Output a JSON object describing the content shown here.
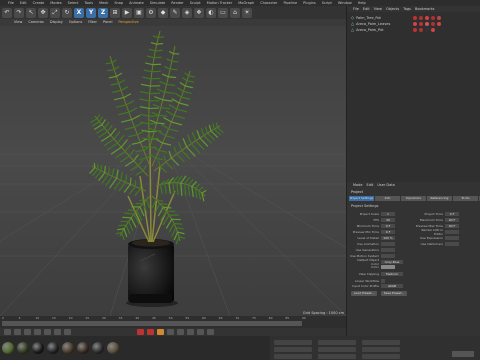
{
  "menubar": [
    "File",
    "Edit",
    "Create",
    "Modes",
    "Select",
    "Tools",
    "Mesh",
    "Snap",
    "Animate",
    "Simulate",
    "Render",
    "Sculpt",
    "Motion Tracker",
    "MoGraph",
    "Character",
    "Pipeline",
    "Plugins",
    "Script",
    "Window",
    "Help"
  ],
  "toolbar_icons": [
    "undo-icon",
    "redo-icon",
    "select-icon",
    "move-icon",
    "scale-icon",
    "rotate-icon",
    "x-axis-icon",
    "y-axis-icon",
    "z-axis-icon",
    "coord-icon",
    "render-view-icon",
    "render-icon",
    "render-settings-icon",
    "cube-icon",
    "pen-icon",
    "subdivision-icon",
    "array-icon",
    "deformer-icon",
    "floor-icon",
    "camera-icon",
    "light-icon"
  ],
  "toolbar_labels": {
    "x": "X",
    "y": "Y",
    "z": "Z"
  },
  "viewport_menu": {
    "items": [
      "View",
      "Cameras",
      "Display",
      "Options",
      "Filter",
      "Panel"
    ],
    "perspective_label": "Perspective"
  },
  "viewport": {
    "readout": "Grid Spacing : 1000 cm"
  },
  "timeline": {
    "ticks": [
      "0",
      "5",
      "10",
      "15",
      "20",
      "25",
      "30",
      "35",
      "40",
      "45",
      "50",
      "55",
      "60",
      "65",
      "70",
      "75",
      "80",
      "85",
      "90"
    ]
  },
  "object_manager": {
    "menu": [
      "File",
      "Edit",
      "View",
      "Objects",
      "Tags",
      "Bookmarks"
    ],
    "objects": [
      {
        "name": "Palm_Tree_Pot"
      },
      {
        "name": "Areca_Palm_Leaves"
      },
      {
        "name": "Areca_Palm_Pot"
      }
    ]
  },
  "attribute_manager": {
    "menu": [
      "Mode",
      "Edit",
      "User Data"
    ],
    "title": "Project",
    "tabs": [
      "Project Settings",
      "Info",
      "Dynamics",
      "Referencing",
      "To Do",
      "Key Interpolation"
    ],
    "section": "Project Settings",
    "fields_left": [
      {
        "label": "Project Scale",
        "value": "1"
      },
      {
        "label": "FPS",
        "value": "30"
      },
      {
        "label": "Minimum Time",
        "value": "0 F"
      },
      {
        "label": "Preview Min Time",
        "value": "0 F"
      },
      {
        "label": "Level of Detail",
        "value": "100 %"
      },
      {
        "label": "Use Animation",
        "value": ""
      },
      {
        "label": "Use Generators",
        "value": ""
      },
      {
        "label": "Use Motion System",
        "value": ""
      }
    ],
    "fields_right": [
      {
        "label": "Project Time",
        "value": "0 F"
      },
      {
        "label": "Maximum Time",
        "value": "90 F"
      },
      {
        "label": "Preview Max Time",
        "value": "90 F"
      },
      {
        "label": "Render LOD in Editor",
        "value": ""
      },
      {
        "label": "Use Expression",
        "value": ""
      },
      {
        "label": "Use Deformers",
        "value": ""
      }
    ],
    "default_color_label": "Default Object Color",
    "default_color_value": "Gray-Blue",
    "color_label": "Color",
    "view_clipping_label": "View Clipping",
    "view_clipping_value": "Medium",
    "linear_workflow_label": "Linear Workflow",
    "input_color_label": "Input Color Profile",
    "input_color_value": "sRGB",
    "load_preset": "Load Preset...",
    "save_preset": "Save Preset..."
  },
  "materials": [
    {
      "color": "#4e6a2b"
    },
    {
      "color": "#2f3b1d"
    },
    {
      "color": "#1a1a1a"
    },
    {
      "color": "#222"
    },
    {
      "color": "#4a3a2a"
    },
    {
      "color": "#3b2a1f"
    },
    {
      "color": "#2b2b2b"
    },
    {
      "color": "#5a4d3a"
    }
  ],
  "colors": {
    "accent": "#3b6fa5",
    "perspective": "#e8a23a",
    "leaf": "#3f7a22",
    "pot": "#0c0c0c"
  }
}
